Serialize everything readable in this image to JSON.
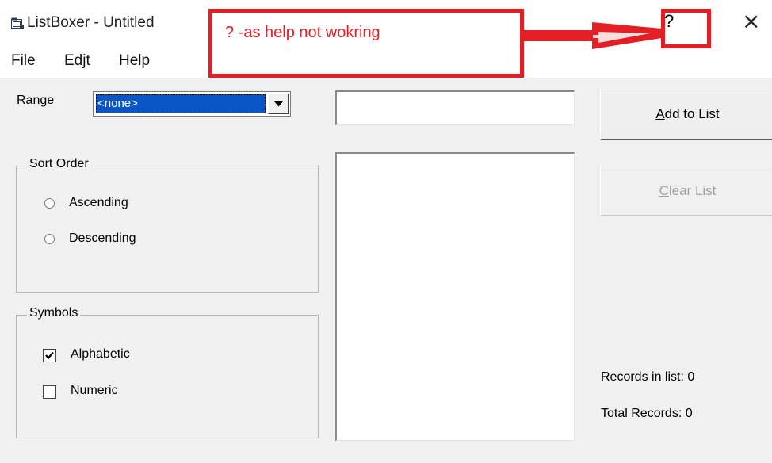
{
  "window": {
    "title": "ListBoxer - Untitled",
    "help_button": "?",
    "close_button": "×"
  },
  "menubar": {
    "items": [
      {
        "label": "File"
      },
      {
        "label": "Edjt"
      },
      {
        "label": "Help"
      }
    ]
  },
  "range": {
    "label": "Range",
    "selected": "<none>"
  },
  "sort_order": {
    "title": "Sort Order",
    "options": [
      {
        "label": "Ascending",
        "selected": false
      },
      {
        "label": "Descending",
        "selected": false
      }
    ]
  },
  "symbols": {
    "title": "Symbols",
    "options": [
      {
        "label": "Alphabetic",
        "checked": true
      },
      {
        "label": "Numeric",
        "checked": false
      }
    ]
  },
  "input": {
    "value": ""
  },
  "buttons": {
    "add": {
      "label": "Add to List",
      "accel": "A",
      "rest": "dd to List"
    },
    "clear": {
      "label": "Clear List",
      "accel": "C",
      "rest": "lear List",
      "disabled": true
    }
  },
  "stats": {
    "records_in_list": "Records in list: 0",
    "total_records": "Total Records: 0"
  },
  "annotation": {
    "text": "? -as help not wokring",
    "color": "#e31e24"
  },
  "colors": {
    "selection": "#0a56c7",
    "dialog_bg": "#f0f0f0"
  }
}
